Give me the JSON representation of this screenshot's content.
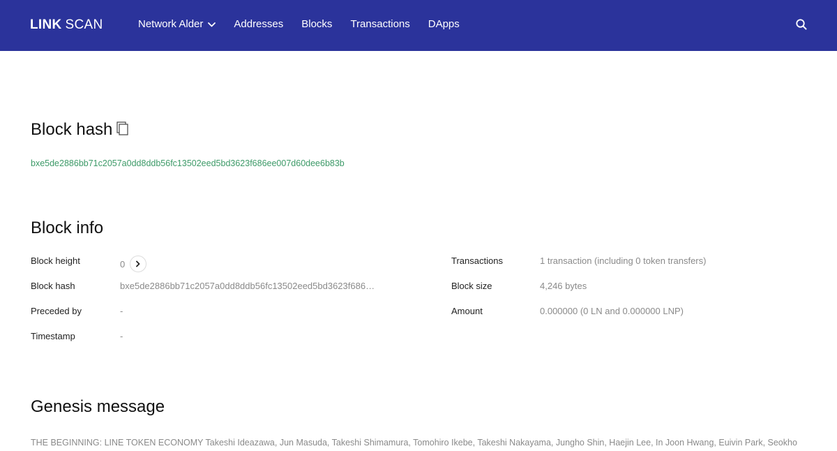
{
  "header": {
    "logo_bold": "LINK",
    "logo_light": "SCAN",
    "nav": [
      {
        "label": "Network Alder"
      },
      {
        "label": "Addresses"
      },
      {
        "label": "Blocks"
      },
      {
        "label": "Transactions"
      },
      {
        "label": "DApps"
      }
    ],
    "brand_color": "#2b339b",
    "search_icon": "search-icon"
  },
  "block_hash_section": {
    "title": "Block hash",
    "hash": "bxe5de2886bb71c2057a0dd8ddb56fc13502eed5bd3623f686ee007d60dee6b83b",
    "hash_color": "#3d9a68"
  },
  "block_info": {
    "title": "Block info",
    "left": [
      {
        "label": "Block height",
        "value": "0"
      },
      {
        "label": "Block hash",
        "value": "bxe5de2886bb71c2057a0dd8ddb56fc13502eed5bd3623f686…"
      },
      {
        "label": "Preceded by",
        "value": "-"
      },
      {
        "label": "Timestamp",
        "value": "-"
      }
    ],
    "right": [
      {
        "label": "Transactions",
        "value": "1 transaction (including 0 token transfers)"
      },
      {
        "label": "Block size",
        "value": "4,246 bytes"
      },
      {
        "label": "Amount",
        "value": "0.000000 (0 LN and 0.000000 LNP)"
      }
    ]
  },
  "genesis": {
    "title": "Genesis message",
    "text": "THE BEGINNING: LINE TOKEN ECONOMY Takeshi Ideazawa, Jun Masuda, Takeshi Shimamura, Tomohiro Ikebe, Takeshi Nakayama, Jungho Shin, Haejin Lee, In Joon Hwang, Euivin Park, Seokho"
  }
}
